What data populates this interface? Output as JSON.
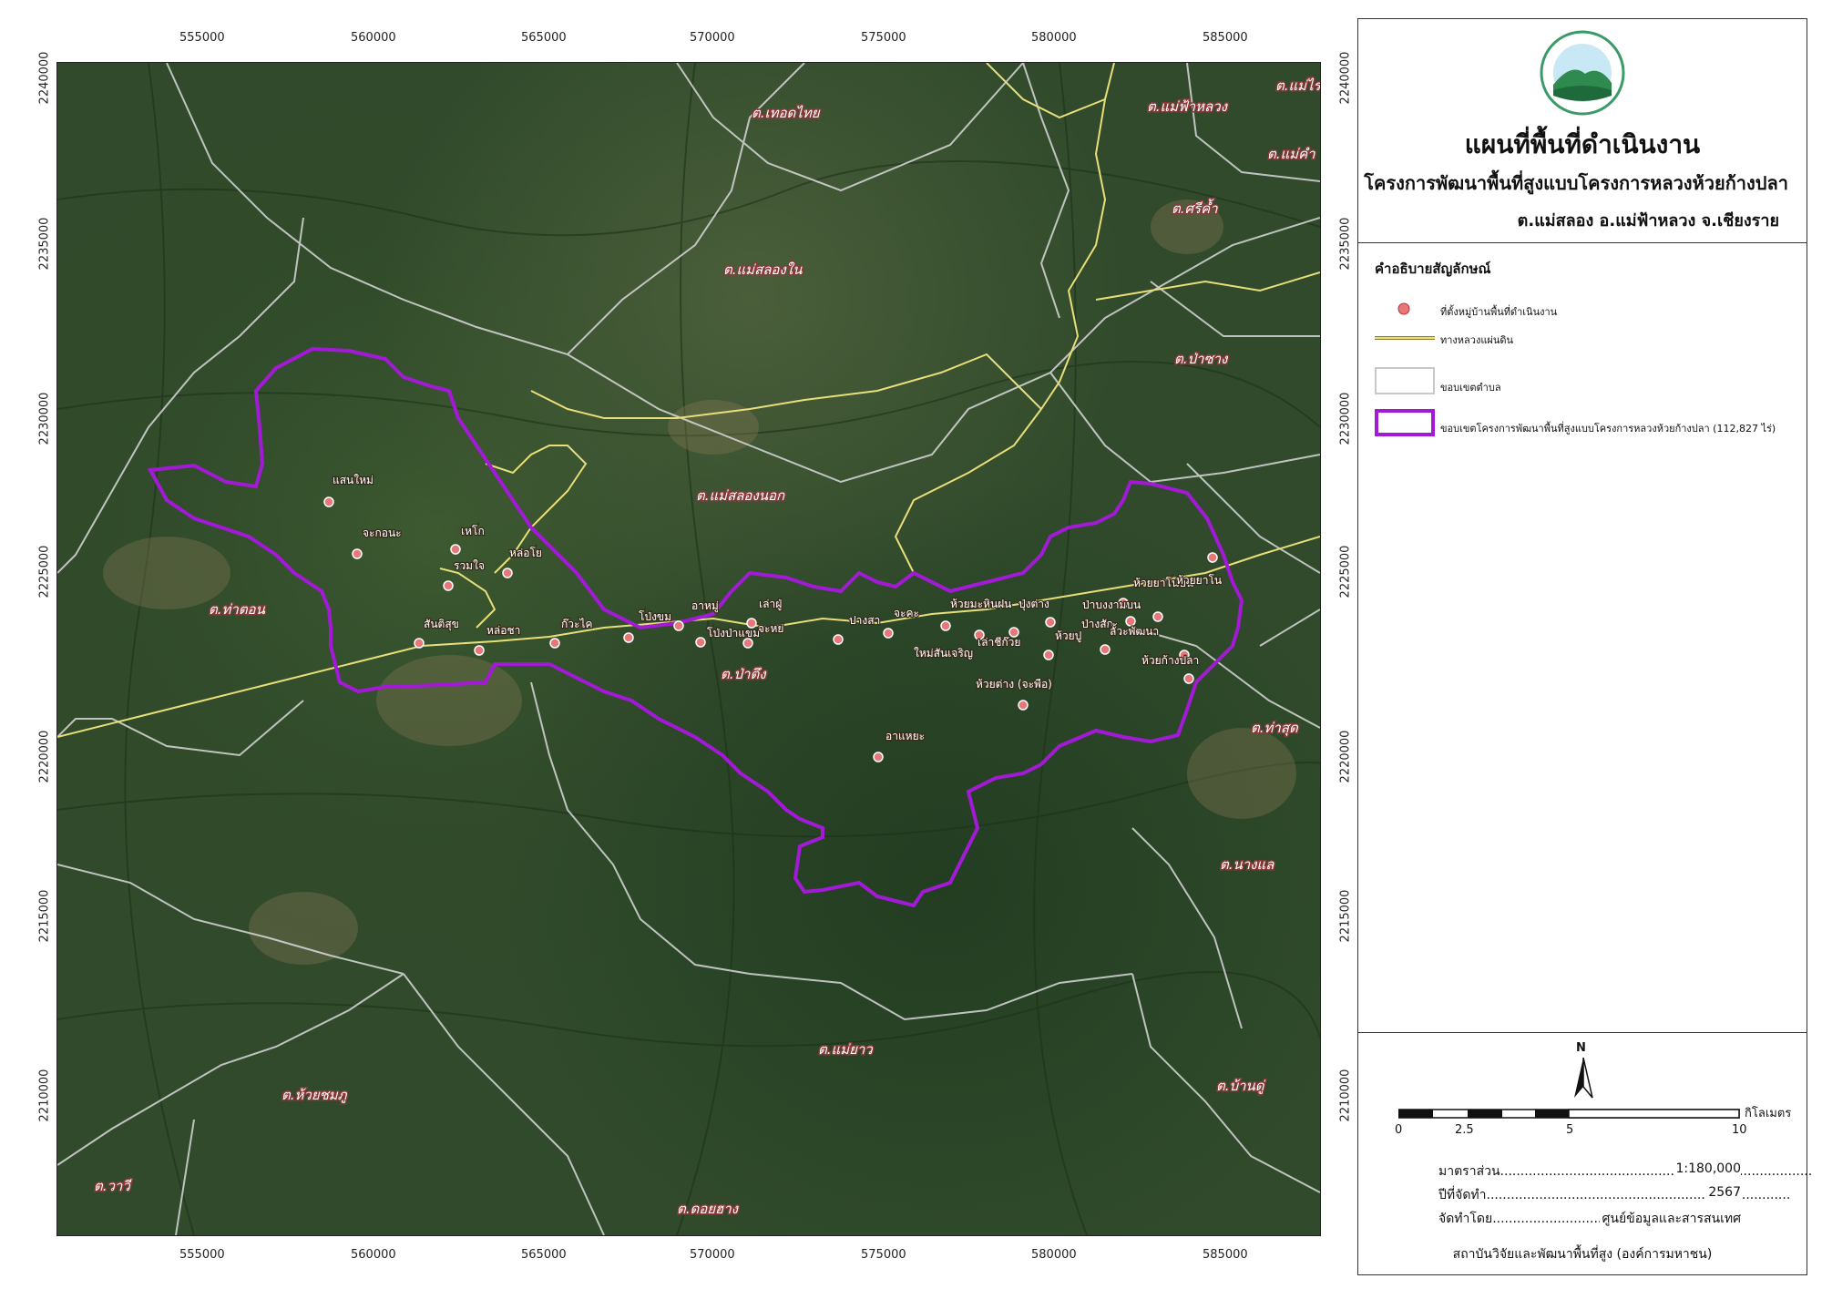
{
  "map": {
    "x_ticks": [
      "555000",
      "560000",
      "565000",
      "570000",
      "575000",
      "580000",
      "585000"
    ],
    "y_ticks": [
      "2240000",
      "2235000",
      "2230000",
      "2225000",
      "2220000",
      "2215000",
      "2210000"
    ],
    "subdistricts": [
      "ต.เทอดไทย",
      "ต.แม่ฟ้าหลวง",
      "ต.แม่ไร่",
      "ต.แม่คำ",
      "ต.ศรีค้ำ",
      "ต.แม่สลองใน",
      "ต.ป่าซาง",
      "ต.แม่สลองนอก",
      "ต.ท่าตอน",
      "ต.ป่าตึง",
      "ต.ท่าสุด",
      "ต.นางแล",
      "ต.แม่ยาว",
      "ต.ห้วยชมภู",
      "ต.บ้านดู่",
      "ต.วาวี",
      "ต.ดอยฮาง"
    ],
    "villages": [
      "แสนใหม่",
      "จะกอนะ",
      "เหโก",
      "หล่อโย",
      "รวมใจ",
      "สันติสุข",
      "หล่อชา",
      "ก๊วะไค",
      "โป่งขม",
      "อาหมู่",
      "โป่งป่าแขม",
      "เล่าฝู่",
      "จะหย่",
      "ปางสา",
      "จะคะ",
      "ห้วยมะหินฝน",
      "ใหม่สันเจริญ",
      "เล่าชีก๊วย",
      "ปุ่งต่าง",
      "ห้วยต่าง (จะพือ)",
      "ห้วยยาโนบน",
      "ป่าบงงามบน",
      "ห้วยยาโน",
      "ป่างสัก",
      "ห้วยปู",
      "ลั้วะพัฒนา",
      "ห้วยก้างปลา",
      "อาแหยะ"
    ]
  },
  "header": {
    "title": "แผนที่พื้นที่ดำเนินงาน",
    "subtitle": "โครงการพัฒนาพื้นที่สูงแบบโครงการหลวงห้วยก้างปลา",
    "location": "ต.แม่สลอง อ.แม่ฟ้าหลวง จ.เชียงราย"
  },
  "legend": {
    "title": "คำอธิบายสัญลักษณ์",
    "items": [
      {
        "label": "ที่ตั้งหมู่บ้านพื้นที่ดำเนินงาน"
      },
      {
        "label": "ทางหลวงแผ่นดิน"
      },
      {
        "label": "ขอบเขตตำบล"
      },
      {
        "label": "ขอบเขตโครงการพัฒนาพื้นที่สูงแบบโครงการหลวงห้วยก้างปลา (112,827 ไร่)"
      }
    ]
  },
  "north": "N",
  "scalebar": {
    "labels": [
      "0",
      "2.5",
      "5",
      "10"
    ],
    "unit": "กิโลเมตร"
  },
  "info": {
    "scale_label": "มาตราส่วน.............................................................................",
    "scale_value": "1:180,000",
    "year_label": "ปีที่จัดทำ...........................................................................",
    "year_value": "2567",
    "by_label": "จัดทำโดย....................................................",
    "by_value": "ศูนย์ข้อมูลและสารสนเทศ",
    "org": "สถาบันวิจัยและพัฒนาพื้นที่สูง (องค์การมหาชน)"
  },
  "colors": {
    "village_marker": "#e8777a",
    "highway": "#e8de7a",
    "subdistrict_boundary": "#d9d9d9",
    "project_boundary": "#a31ad6"
  }
}
